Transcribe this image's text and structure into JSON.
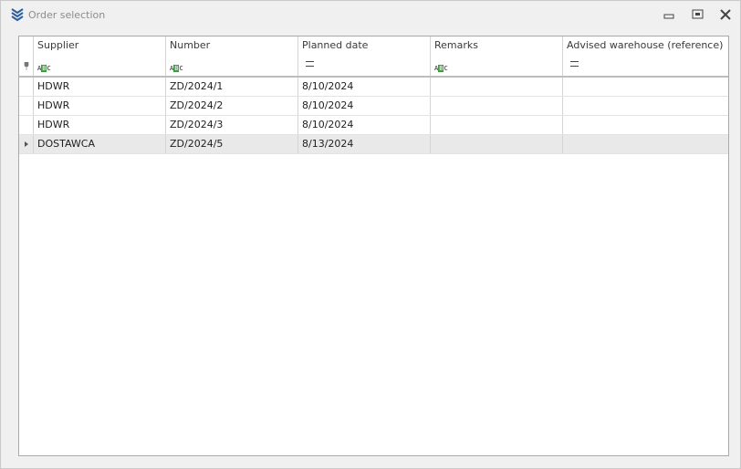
{
  "window": {
    "title": "Order selection"
  },
  "grid": {
    "columns": [
      "Supplier",
      "Number",
      "Planned date",
      "Remarks",
      "Advised warehouse (reference)"
    ],
    "filter_row": [
      {
        "icon": "text-filter-icon",
        "label": "ABC"
      },
      {
        "icon": "text-filter-icon",
        "label": "ABC"
      },
      {
        "icon": "equals-filter-icon",
        "label": ""
      },
      {
        "icon": "text-filter-icon",
        "label": "ABC"
      },
      {
        "icon": "equals-filter-icon",
        "label": ""
      }
    ],
    "rows": [
      {
        "supplier": "HDWR",
        "number": "ZD/2024/1",
        "planned_date": "8/10/2024",
        "remarks": "",
        "warehouse": ""
      },
      {
        "supplier": "HDWR",
        "number": "ZD/2024/2",
        "planned_date": "8/10/2024",
        "remarks": "",
        "warehouse": ""
      },
      {
        "supplier": "HDWR",
        "number": "ZD/2024/3",
        "planned_date": "8/10/2024",
        "remarks": "",
        "warehouse": ""
      },
      {
        "supplier": "DOSTAWCA",
        "number": "ZD/2024/5",
        "planned_date": "8/13/2024",
        "remarks": "",
        "warehouse": "",
        "focused": true
      }
    ]
  },
  "colors": {
    "focused_row": "#e9e9e9",
    "icon_blue": "#2e5e9c",
    "filter_green": "#3f9b3f"
  }
}
